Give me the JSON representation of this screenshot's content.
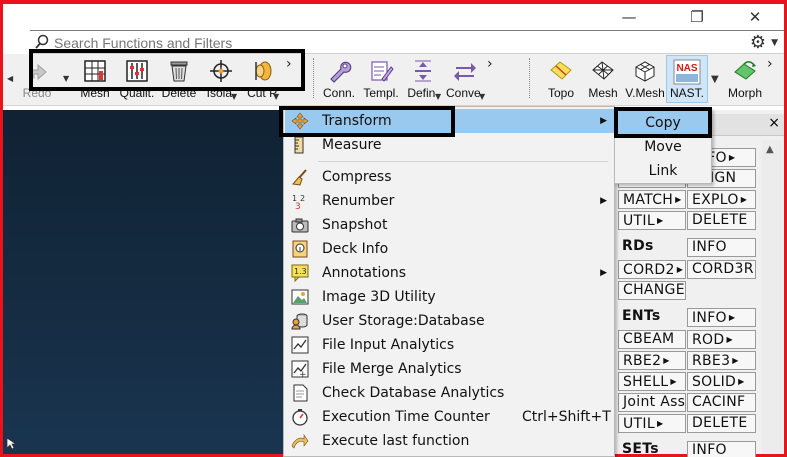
{
  "window": {
    "minimize_glyph": "—",
    "restore_glyph": "❐",
    "close_glyph": "✕"
  },
  "search": {
    "placeholder": "Search Functions and Filters",
    "value": "",
    "settings_icon": "gear-icon"
  },
  "toolbar": {
    "left_group": [
      {
        "label": "Redo",
        "icon": "redo-arrow-icon"
      },
      {
        "label": "Mesh",
        "icon": "mesh-grid-icon"
      },
      {
        "label": "Qualit.",
        "icon": "quality-sliders-icon"
      },
      {
        "label": "Delete",
        "icon": "trash-icon"
      },
      {
        "label": "Isola.",
        "icon": "isolate-crosshair-icon"
      },
      {
        "label": "Cut P.",
        "icon": "cut-plane-icon"
      }
    ],
    "mid_group": [
      {
        "label": "Conn.",
        "icon": "connection-wrench-icon"
      },
      {
        "label": "Templ.",
        "icon": "template-pencil-icon"
      },
      {
        "label": "Defin.",
        "icon": "define-arrows-icon"
      },
      {
        "label": "Conve.",
        "icon": "convert-arrows-icon"
      }
    ],
    "right_group": [
      {
        "label": "Topo",
        "icon": "topo-surface-icon"
      },
      {
        "label": "Mesh",
        "icon": "mesh-surface-icon"
      },
      {
        "label": "V.Mesh",
        "icon": "volume-mesh-icon"
      },
      {
        "label": "NAST.",
        "icon": "nastran-icon",
        "badge": "NAS"
      },
      {
        "label": "Morph",
        "icon": "morph-icon"
      }
    ],
    "overflow_glyph": "›"
  },
  "context_menu": {
    "items": [
      {
        "label": "Transform",
        "icon": "transform-arrows-icon",
        "submenu": true,
        "selected": true,
        "shortcut": ""
      },
      {
        "label": "Measure",
        "icon": "ruler-icon",
        "submenu": false,
        "selected": false,
        "shortcut": ""
      },
      {
        "label": "Compress",
        "icon": "broom-icon",
        "submenu": false,
        "selected": false,
        "shortcut": ""
      },
      {
        "label": "Renumber",
        "icon": "renumber-icon",
        "submenu": true,
        "selected": false,
        "shortcut": ""
      },
      {
        "label": "Snapshot",
        "icon": "camera-icon",
        "submenu": false,
        "selected": false,
        "shortcut": ""
      },
      {
        "label": "Deck Info",
        "icon": "deck-info-icon",
        "submenu": false,
        "selected": false,
        "shortcut": ""
      },
      {
        "label": "Annotations",
        "icon": "annotation-icon",
        "submenu": true,
        "selected": false,
        "shortcut": ""
      },
      {
        "label": "Image 3D Utility",
        "icon": "image-icon",
        "submenu": false,
        "selected": false,
        "shortcut": ""
      },
      {
        "label": "User Storage:Database",
        "icon": "database-user-icon",
        "submenu": false,
        "selected": false,
        "shortcut": ""
      },
      {
        "label": "File Input Analytics",
        "icon": "chart-file-icon",
        "submenu": false,
        "selected": false,
        "shortcut": ""
      },
      {
        "label": "File Merge Analytics",
        "icon": "merge-chart-icon",
        "submenu": false,
        "selected": false,
        "shortcut": ""
      },
      {
        "label": "Check Database Analytics",
        "icon": "check-doc-icon",
        "submenu": false,
        "selected": false,
        "shortcut": ""
      },
      {
        "label": "Execution Time Counter",
        "icon": "stopwatch-icon",
        "submenu": false,
        "selected": false,
        "shortcut": "Ctrl+Shift+T"
      },
      {
        "label": "Execute last function",
        "icon": "execute-arrow-icon",
        "submenu": false,
        "selected": false,
        "shortcut": ""
      }
    ],
    "submenu_arrow": "▶"
  },
  "submenu": {
    "items": [
      {
        "label": "Copy",
        "selected": true
      },
      {
        "label": "Move",
        "selected": false
      },
      {
        "label": "Link",
        "selected": false
      }
    ]
  },
  "side_panel": {
    "close_glyph": "×",
    "scroll_up_glyph": "▲",
    "rows": [
      {
        "cells": [
          {
            "text": "",
            "arrow": false
          },
          {
            "text": "INFO",
            "arrow": true
          }
        ]
      },
      {
        "cells": [
          {
            "text": "",
            "arrow": false
          },
          {
            "text": "ALIGN",
            "arrow": false
          }
        ]
      },
      {
        "cells": [
          {
            "text": "MATCH",
            "arrow": true
          },
          {
            "text": "EXPLO",
            "arrow": true
          }
        ]
      },
      {
        "cells": [
          {
            "text": "UTIL",
            "arrow": true
          },
          {
            "text": "DELETE",
            "arrow": false
          }
        ]
      },
      {
        "heading": "RDs",
        "cells": [
          {
            "text": "INFO",
            "arrow": false
          }
        ]
      },
      {
        "cells": [
          {
            "text": "CORD2",
            "arrow": true
          },
          {
            "text": "CORD3R",
            "arrow": false
          }
        ]
      },
      {
        "cells": [
          {
            "text": "CHANGE.",
            "arrow": false
          }
        ]
      },
      {
        "heading": "ENTs",
        "cells": [
          {
            "text": "INFO",
            "arrow": true
          }
        ]
      },
      {
        "cells": [
          {
            "text": "CBEAM",
            "arrow": false
          },
          {
            "text": "ROD",
            "arrow": true
          }
        ]
      },
      {
        "cells": [
          {
            "text": "RBE2",
            "arrow": true
          },
          {
            "text": "RBE3",
            "arrow": true
          }
        ]
      },
      {
        "cells": [
          {
            "text": "SHELL",
            "arrow": true
          },
          {
            "text": "SOLID",
            "arrow": true
          }
        ]
      },
      {
        "cells": [
          {
            "text": "Joint Assi.",
            "arrow": false
          },
          {
            "text": "CACINF",
            "arrow": false
          }
        ]
      },
      {
        "cells": [
          {
            "text": "UTIL",
            "arrow": true
          },
          {
            "text": "DELETE",
            "arrow": false
          }
        ]
      },
      {
        "heading": "SETs",
        "cells": [
          {
            "text": "INFO",
            "arrow": false
          }
        ]
      }
    ]
  }
}
